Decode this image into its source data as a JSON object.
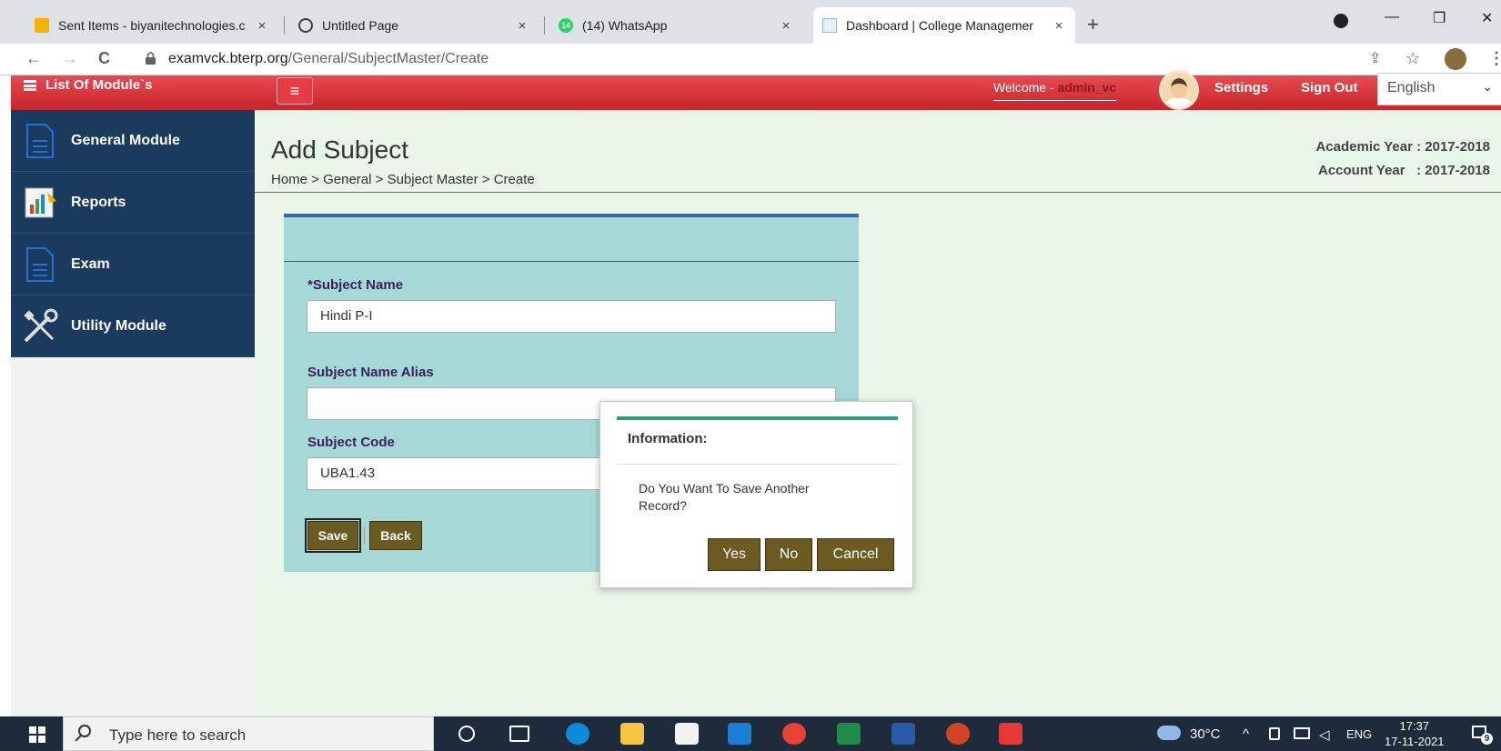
{
  "browser": {
    "tabs": [
      {
        "title": "Sent Items - biyanitechnologies.c",
        "close": "×"
      },
      {
        "title": "Untitled Page",
        "close": "×"
      },
      {
        "title": "(14) WhatsApp",
        "close": "×",
        "badge": "14"
      },
      {
        "title": "Dashboard | College Managemer",
        "close": "×"
      }
    ],
    "new_tab": "+",
    "url_host": "examvck.bterp.org",
    "url_path": "/General/SubjectMaster/Create",
    "window_controls": {
      "minimize": "—",
      "restore": "❐",
      "close": "✕"
    },
    "nav": {
      "back": "←",
      "forward": "→",
      "reload": "C"
    },
    "right_icons": {
      "share": "⇪",
      "star": "☆",
      "menu": "⋮"
    }
  },
  "header": {
    "modules_label": "List Of Module`s",
    "menu_glyph": "≡",
    "welcome_prefix": "Welcome - ",
    "username": "admin_vc",
    "settings": "Settings",
    "signout": "Sign Out",
    "language": "English",
    "language_chevron": "⌄"
  },
  "sidebar": {
    "items": [
      {
        "label": "General Module",
        "icon": "document-icon"
      },
      {
        "label": "Reports",
        "icon": "report-chart-icon"
      },
      {
        "label": "Exam",
        "icon": "document-icon"
      },
      {
        "label": "Utility Module",
        "icon": "tools-icon"
      }
    ]
  },
  "page": {
    "title": "Add Subject",
    "breadcrumb": "Home > General > Subject Master > Create",
    "academic_year": "Academic Year : 2017-2018",
    "account_year": "Account Year   : 2017-2018"
  },
  "form": {
    "subject_name_label": "*Subject Name",
    "subject_name_value": "Hindi P-I",
    "alias_label": "Subject Name Alias",
    "alias_value": "",
    "code_label": "Subject Code",
    "code_value": "UBA1.43",
    "save": "Save",
    "back": "Back"
  },
  "dialog": {
    "title": "Information:",
    "message": "Do You Want To Save Another Record?",
    "yes": "Yes",
    "no": "No",
    "cancel": "Cancel"
  },
  "taskbar": {
    "search_placeholder": "Type here to search",
    "temperature": "30°C",
    "tray_caret": "^",
    "lang": "ENG",
    "time": "17:37",
    "date": "17-11-2021",
    "notif_count": "9"
  },
  "colors": {
    "header_red": "#d8333a",
    "sidebar_navy": "#1a3a5e",
    "form_teal": "#a7d8d8",
    "button_olive": "#6b5a22",
    "dialog_accent": "#2a9a82",
    "main_bg": "#e9f5e8"
  }
}
